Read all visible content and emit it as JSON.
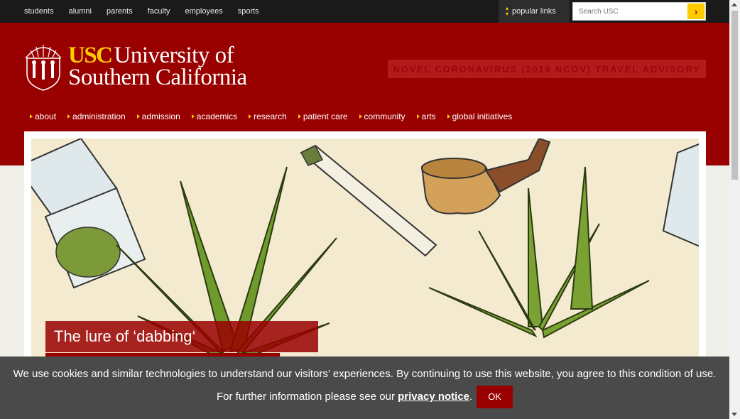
{
  "topbar": {
    "links": [
      "students",
      "alumni",
      "parents",
      "faculty",
      "employees",
      "sports"
    ],
    "popular_label": "popular links",
    "search_placeholder": "Search USC",
    "search_go_icon": "chevron-right-icon"
  },
  "header": {
    "logo_usc": "USC",
    "logo_line1": "University of",
    "logo_line2": "Southern California",
    "advisory": "NOVEL CORONAVIRUS (2019 NCOV) TRAVEL ADVISORY",
    "nav": [
      "about",
      "administration",
      "admission",
      "academics",
      "research",
      "patient care",
      "community",
      "arts",
      "global initiatives"
    ]
  },
  "hero": {
    "headline": "The lure of ‘dabbing‘"
  },
  "cookie": {
    "text_before": "We use cookies and similar technologies to understand our visitors’ experiences. By continuing to use this website, you agree to this condition of use. For further information please see our ",
    "link": "privacy notice",
    "text_after": ".",
    "ok": "OK"
  },
  "colors": {
    "cardinal": "#990000",
    "gold": "#ffcc00",
    "topbar": "#1a1a1a",
    "cookie_bg": "#4a4a4a"
  }
}
